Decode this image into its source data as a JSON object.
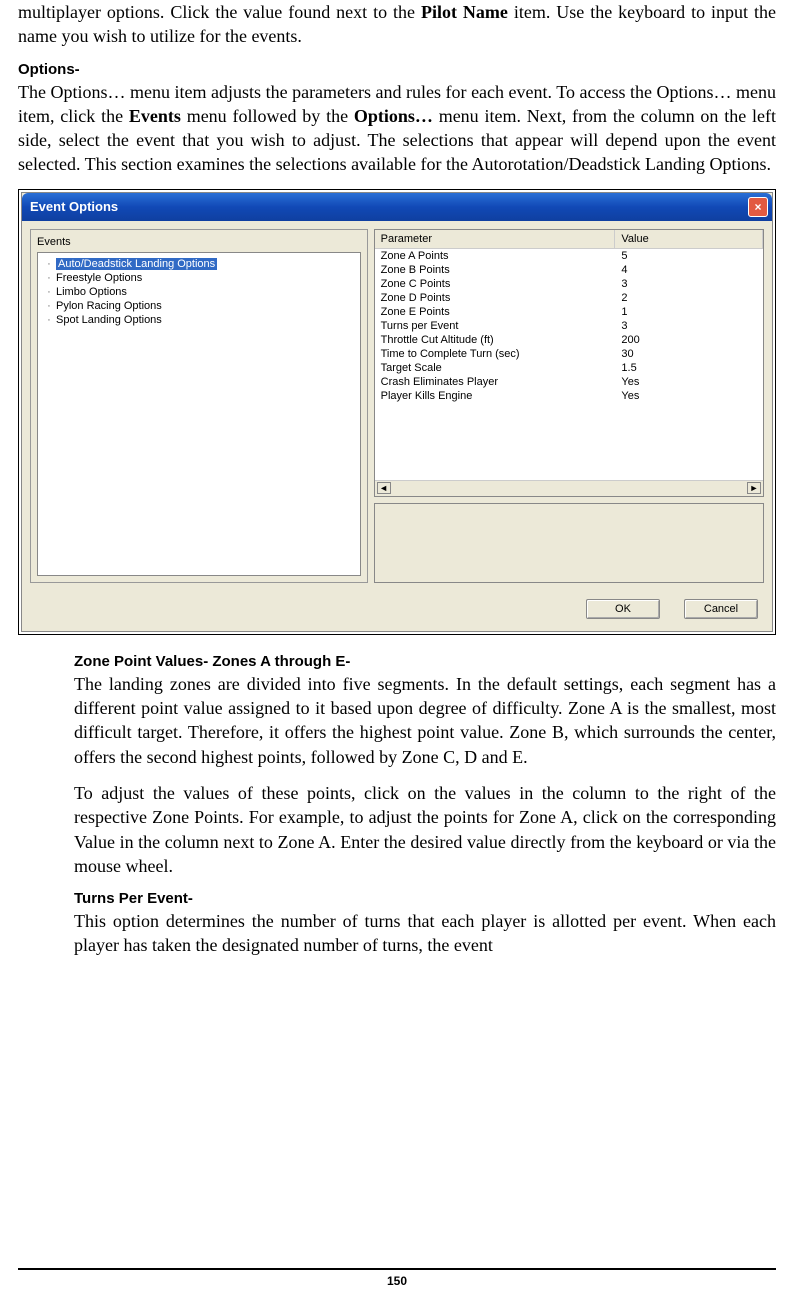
{
  "intro_para": "multiplayer options.  Click the value found next to the <b>Pilot Name</b> item.  Use the keyboard to input the name you wish to utilize for the events.",
  "options_heading": "Options-",
  "options_para": "The Options… menu item adjusts the parameters and rules for each event.  To access the Options… menu item, click the <b>Events</b> menu followed by the <b>Options…</b> menu item.  Next, from the column on the left side, select the event that you wish to adjust.  The selections that appear will depend upon the event selected.  This section examines the selections available for the Autorotation/Deadstick Landing Options.",
  "dialog": {
    "title": "Event Options",
    "close_glyph": "×",
    "events_label": "Events",
    "tree_items": [
      {
        "label": "Auto/Deadstick Landing Options",
        "selected": true
      },
      {
        "label": "Freestyle Options",
        "selected": false
      },
      {
        "label": "Limbo Options",
        "selected": false
      },
      {
        "label": "Pylon Racing Options",
        "selected": false
      },
      {
        "label": "Spot Landing Options",
        "selected": false
      }
    ],
    "param_header": {
      "param": "Parameter",
      "value": "Value"
    },
    "params": [
      {
        "param": "Zone A Points",
        "value": "5"
      },
      {
        "param": "Zone B Points",
        "value": "4"
      },
      {
        "param": "Zone C Points",
        "value": "3"
      },
      {
        "param": "Zone D Points",
        "value": "2"
      },
      {
        "param": "Zone E Points",
        "value": "1"
      },
      {
        "param": "Turns per Event",
        "value": "3"
      },
      {
        "param": "Throttle Cut Altitude (ft)",
        "value": "200"
      },
      {
        "param": "Time to Complete Turn (sec)",
        "value": "30"
      },
      {
        "param": "Target Scale",
        "value": "1.5"
      },
      {
        "param": "Crash Eliminates Player",
        "value": "Yes"
      },
      {
        "param": "Player Kills Engine",
        "value": "Yes"
      }
    ],
    "buttons": {
      "ok": "OK",
      "cancel": "Cancel"
    }
  },
  "zone_section": {
    "heading": "Zone Point Values- Zones A through E-",
    "para1": "The landing zones are divided into five segments.  In the default settings, each segment has a different point value assigned to it based upon degree of difficulty.  Zone A is the smallest, most difficult target.  Therefore, it offers the highest point value.  Zone B, which surrounds the center, offers the second highest points, followed by Zone C, D and E.",
    "para2": "To adjust the values of these points, click on the values in the column to the right of the respective Zone Points.  For example, to adjust the points for Zone A, click on the corresponding Value in the column next to Zone A.  Enter the desired value directly from the keyboard or via the mouse wheel."
  },
  "turns_section": {
    "heading": "Turns Per Event-",
    "para": "This option determines the number of turns that each player is allotted per event.  When each player has taken the designated number of turns, the event"
  },
  "page_number": "150"
}
